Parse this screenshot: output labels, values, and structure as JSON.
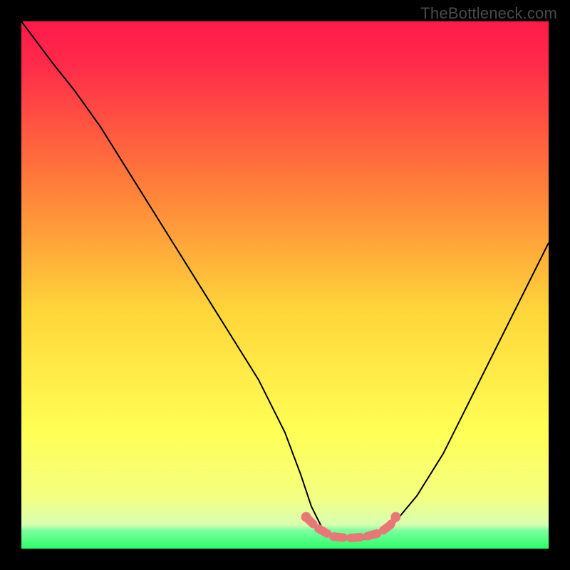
{
  "watermark": "TheBottleneck.com",
  "chart_data": {
    "type": "line",
    "title": "",
    "xlabel": "",
    "ylabel": "",
    "xlim": [
      0,
      100
    ],
    "ylim": [
      0,
      100
    ],
    "background_gradient": {
      "top": "#ff1a4a",
      "mid_upper": "#ff8a3a",
      "mid": "#ffe63a",
      "mid_lower": "#f8ff60",
      "green_band": "#2aff6a",
      "bottom": "#2aff6a"
    },
    "series": [
      {
        "name": "bottleneck-curve",
        "x": [
          0,
          3,
          6,
          10,
          15,
          20,
          25,
          30,
          35,
          40,
          45,
          50,
          53,
          55,
          57,
          60,
          63,
          66,
          70,
          75,
          80,
          85,
          90,
          95,
          100
        ],
        "y": [
          100,
          96,
          92,
          87,
          80,
          72,
          64,
          56,
          48,
          40,
          32,
          22,
          14,
          8,
          4,
          2,
          1.5,
          2,
          4,
          10,
          18,
          28,
          38,
          48,
          58
        ],
        "color": "#000000"
      }
    ],
    "green_band_y_range": [
      0,
      5
    ],
    "markers": {
      "name": "highlight-dots",
      "color": "#e87878",
      "points": [
        {
          "x": 54,
          "y": 6
        },
        {
          "x": 56,
          "y": 4
        },
        {
          "x": 59,
          "y": 2.3
        },
        {
          "x": 62,
          "y": 2
        },
        {
          "x": 65,
          "y": 2.2
        },
        {
          "x": 68,
          "y": 3
        },
        {
          "x": 70,
          "y": 4.5
        },
        {
          "x": 71,
          "y": 6
        }
      ]
    }
  }
}
